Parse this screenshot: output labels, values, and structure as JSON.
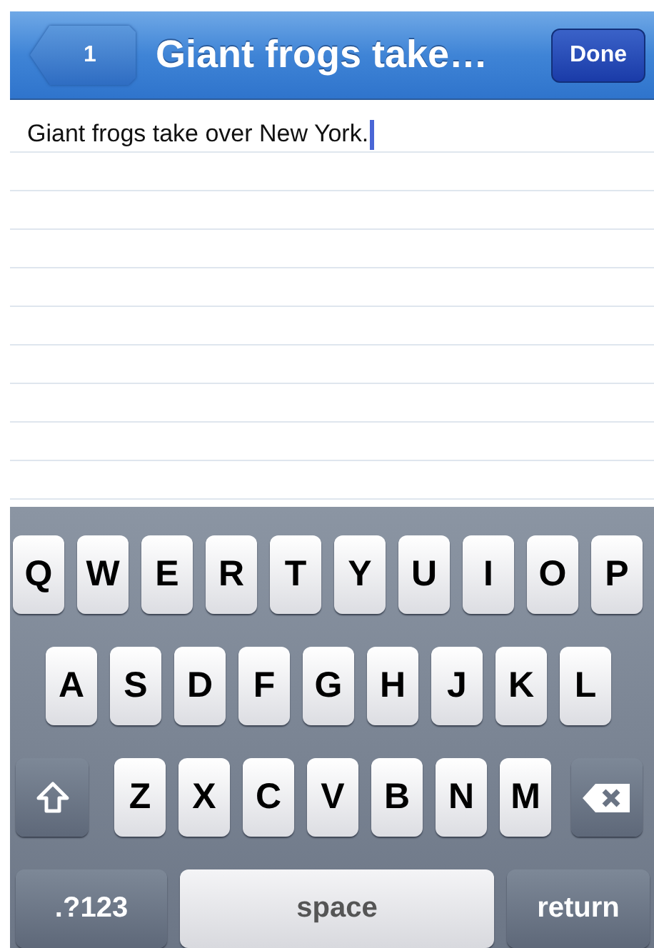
{
  "nav_bar": {
    "back_button": "1",
    "title": "Giant frogs take…",
    "done_button": "Done"
  },
  "note": {
    "text": "Giant frogs take over New York.",
    "focused": true
  },
  "keyboard": {
    "top_row": [
      {
        "kind": "letter",
        "label": "Q"
      },
      {
        "kind": "letter",
        "label": "W"
      },
      {
        "kind": "letter",
        "label": "E"
      },
      {
        "kind": "letter",
        "label": "R"
      },
      {
        "kind": "letter",
        "label": "T"
      },
      {
        "kind": "letter",
        "label": "Y"
      },
      {
        "kind": "letter",
        "label": "U"
      },
      {
        "kind": "letter",
        "label": "I"
      },
      {
        "kind": "letter",
        "label": "O"
      },
      {
        "kind": "letter",
        "label": "P"
      }
    ],
    "middle_row": [
      {
        "kind": "letter",
        "label": "A"
      },
      {
        "kind": "letter",
        "label": "S"
      },
      {
        "kind": "letter",
        "label": "D"
      },
      {
        "kind": "letter",
        "label": "F"
      },
      {
        "kind": "letter",
        "label": "G"
      },
      {
        "kind": "letter",
        "label": "H"
      },
      {
        "kind": "letter",
        "label": "J"
      },
      {
        "kind": "letter",
        "label": "K"
      },
      {
        "kind": "letter",
        "label": "L"
      }
    ],
    "bottom_row": [
      {
        "kind": "shift"
      },
      {
        "kind": "letter",
        "label": "Z"
      },
      {
        "kind": "letter",
        "label": "X"
      },
      {
        "kind": "letter",
        "label": "C"
      },
      {
        "kind": "letter",
        "label": "V"
      },
      {
        "kind": "letter",
        "label": "B"
      },
      {
        "kind": "letter",
        "label": "N"
      },
      {
        "kind": "letter",
        "label": "M"
      },
      {
        "kind": "delete"
      }
    ],
    "numbers_key": ".?123",
    "space_key": "space",
    "return_key": "return"
  }
}
